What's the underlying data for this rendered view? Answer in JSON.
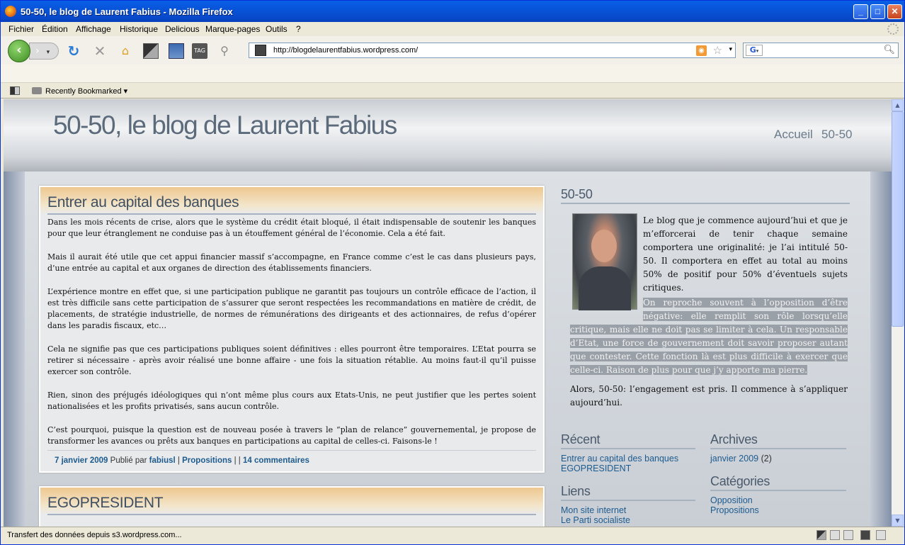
{
  "window": {
    "title": "50-50, le blog de Laurent Fabius - Mozilla Firefox"
  },
  "menu": [
    "Fichier",
    "Édition",
    "Affichage",
    "Historique",
    "Delicious",
    "Marque-pages",
    "Outils",
    "?"
  ],
  "toolbar": {
    "url": "http://blogdelaurentfabius.wordpress.com/",
    "search_engine": "G",
    "tag_label": "TAG"
  },
  "bookmarks": {
    "recent_label": "Recently Bookmarked"
  },
  "blog": {
    "title": "50-50, le blog de Laurent Fabius",
    "nav": [
      "Accueil",
      "50-50"
    ]
  },
  "post1": {
    "title": "Entrer au capital des banques",
    "paragraphs": [
      "Dans les mois récents de crise, alors que le système du crédit était bloqué, il était indispensable de soutenir les banques pour que leur étranglement ne conduise pas à un étouffement général de l’économie. Cela a été fait.",
      "Mais il aurait été utile que cet appui financier massif s’accompagne, en France comme c’est le cas dans plusieurs pays, d’une entrée au capital et aux organes de direction des établissements financiers.",
      "L’expérience montre en effet que, si une participation publique ne garantit pas toujours un contrôle efficace de l’action, il est très difficile sans cette participation de s’assurer que seront respectées les recommandations en matière de crédit, de placements, de stratégie industrielle, de normes de rémunérations des dirigeants et des actionnaires, de refus d’opérer dans les paradis fiscaux, etc…",
      "Cela ne signifie pas que ces participations publiques soient définitives : elles pourront être temporaires. L’Etat pourra se retirer si nécessaire - après avoir réalisé une bonne affaire - une fois la situation rétablie. Au moins faut-il qu’il puisse exercer son contrôle.",
      "Rien, sinon des préjugés idéologiques qui n’ont même plus cours aux Etats-Unis, ne peut justifier  que les pertes soient nationalisées et les profits privatisés, sans aucun contrôle.",
      "C’est pourquoi, puisque la question est de nouveau posée à travers le “plan de relance” gouvernemental, je propose de transformer les avances ou prêts aux banques en participations au capital de celles-ci. Faisons-le !"
    ],
    "date": "7 janvier 2009",
    "published_by": "Publié par",
    "author": "fabiusl",
    "sep1": "|",
    "category": "Propositions",
    "sep2": "| |",
    "comments": "14 commentaires"
  },
  "post2": {
    "title": "EGOPRESIDENT"
  },
  "about": {
    "heading": "50-50",
    "p1": "Le blog que je commence aujourd’hui et que je m’efforcerai de tenir chaque semaine comportera une originalité: je l’ai intitulé 50-50. Il comportera en effet au total au moins 50% de positif pour 50% d’éventuels sujets critiques.",
    "p2": "On reproche souvent à l’opposition d’être négative: elle remplit son rôle lorsqu’elle critique, mais elle ne doit pas se limiter à cela. Un responsable d’Etat, une force de gouvernement doit savoir proposer autant que contester. Cette fonction là est plus difficile à exercer que celle-ci. Raison de plus pour que j’y apporte ma pierre.",
    "p3": "Alors, 50-50: l’engagement est pris. Il commence à s’appliquer aujourd’hui."
  },
  "recent": {
    "heading": "Récent",
    "items": [
      "Entrer au capital des banques",
      "EGOPRESIDENT"
    ]
  },
  "archives": {
    "heading": "Archives",
    "month": "janvier 2009",
    "count": "(2)"
  },
  "links": {
    "heading": "Liens",
    "items": [
      "Mon site internet",
      "Le Parti socialiste"
    ]
  },
  "categories": {
    "heading": "Catégories",
    "items": [
      "Opposition",
      "Propositions"
    ]
  },
  "status": {
    "text": "Transfert des données depuis s3.wordpress.com..."
  }
}
